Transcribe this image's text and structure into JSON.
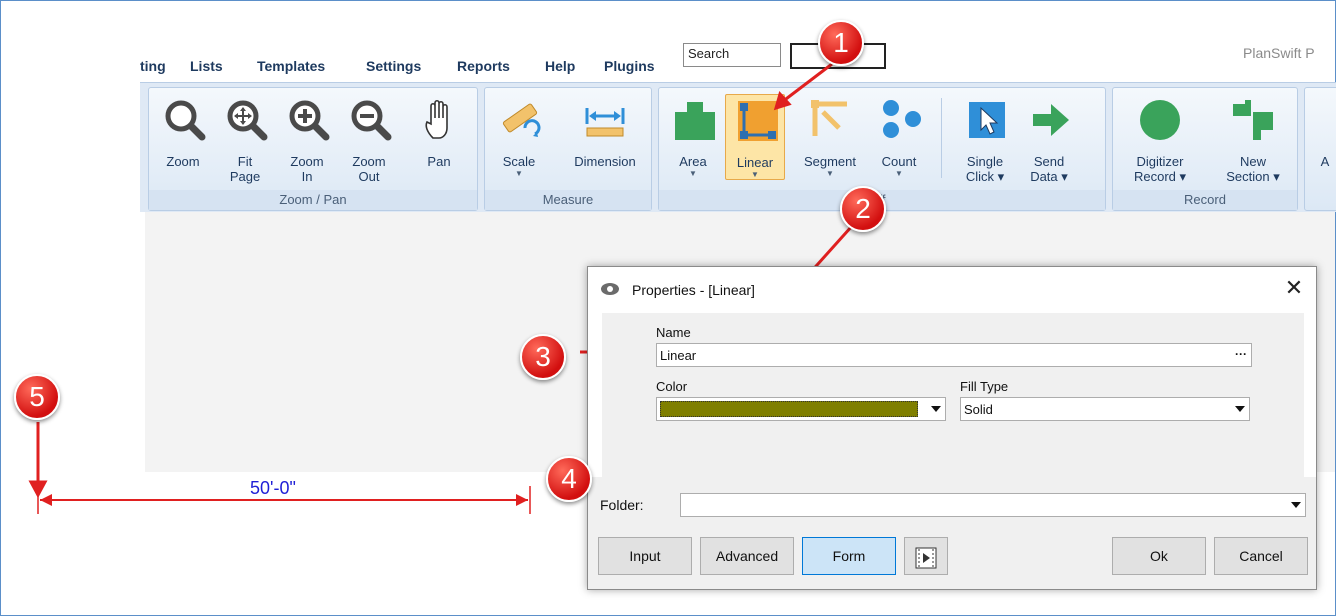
{
  "menubar": {
    "items": [
      "ting",
      "Lists",
      "Templates",
      "Settings",
      "Reports",
      "Help",
      "Plugins"
    ],
    "search_value": "Search",
    "app_title": "PlanSwift P"
  },
  "ribbon": {
    "groups": [
      {
        "label": "Zoom / Pan",
        "buttons": [
          "Zoom",
          "Fit Page",
          "Zoom In",
          "Zoom Out",
          "Pan"
        ]
      },
      {
        "label": "Measure",
        "buttons": [
          "Scale",
          "Dimension"
        ]
      },
      {
        "label": "ff",
        "buttons": [
          "Area",
          "Linear",
          "Segment",
          "Count",
          "Single Click",
          "Send Data"
        ]
      },
      {
        "label": "Record",
        "buttons": [
          "Digitizer Record",
          "New Section"
        ]
      },
      {
        "label": "",
        "buttons": [
          "A"
        ]
      }
    ],
    "active_button": "Linear"
  },
  "labels": {
    "zoom": "Zoom",
    "fit1": "Fit",
    "fit2": "Page",
    "zoomin1": "Zoom",
    "zoomin2": "In",
    "zoomout1": "Zoom",
    "zoomout2": "Out",
    "pan": "Pan",
    "scale": "Scale",
    "dimension": "Dimension",
    "area": "Area",
    "linear": "Linear",
    "segment": "Segment",
    "count": "Count",
    "single1": "Single",
    "single2": "Click",
    "send1": "Send",
    "send2": "Data",
    "digit1": "Digitizer",
    "digit2": "Record",
    "new1": "New",
    "new2": "Section",
    "a": "A"
  },
  "dialog": {
    "title": "Properties - [Linear]",
    "close_glyph": "✕",
    "name_label": "Name",
    "name_value": "Linear",
    "color_label": "Color",
    "color_value": "#7f7f00",
    "fill_type_label": "Fill Type",
    "fill_type_value": "Solid",
    "folder_label": "Folder:",
    "folder_value": "",
    "buttons": {
      "input": "Input",
      "advanced": "Advanced",
      "form": "Form",
      "ok": "Ok",
      "cancel": "Cancel"
    }
  },
  "canvas": {
    "dimension_text": "50'-0\""
  },
  "callouts": [
    "1",
    "2",
    "3",
    "4",
    "5"
  ],
  "colors": {
    "accent": "#d20f0f",
    "ribbon_bg": "#dfe9f5",
    "icon_green": "#3aa35b",
    "icon_orange": "#f0a030",
    "icon_blue": "#2f8fd8"
  }
}
